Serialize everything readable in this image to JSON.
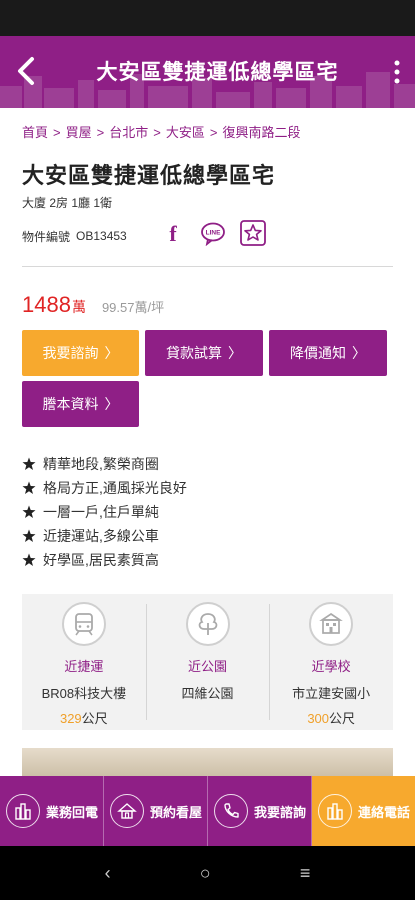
{
  "header": {
    "title": "大安區雙捷運低總學區宅"
  },
  "breadcrumb": [
    "首頁",
    "買屋",
    "台北市",
    "大安區",
    "復興南路二段"
  ],
  "listing": {
    "title": "大安區雙捷運低總學區宅",
    "spec": "大廈 2房 1廳 1衛",
    "object_label": "物件編號",
    "object_no": "OB13453",
    "price": "1488",
    "price_unit": "萬",
    "unit_price": "99.57萬/坪"
  },
  "share": {
    "facebook": "f",
    "line": "LINE"
  },
  "buttons": {
    "inquire": "我要諮詢",
    "loan": "貸款試算",
    "price_alert": "降價通知",
    "transcript": "謄本資料"
  },
  "features": [
    "精華地段,繁榮商圈",
    "格局方正,通風採光良好",
    "一層一戶,住戶單純",
    "近捷運站,多線公車",
    "好學區,居民素質高"
  ],
  "nearby": [
    {
      "title": "近捷運",
      "name": "BR08科技大樓",
      "distance": "329",
      "unit": "公尺"
    },
    {
      "title": "近公園",
      "name": "四維公園",
      "distance": "",
      "unit": ""
    },
    {
      "title": "近學校",
      "name": "市立建安國小",
      "distance": "300",
      "unit": "公尺"
    }
  ],
  "bottom_nav": [
    "業務回電",
    "預約看屋",
    "我要諮詢",
    "連絡電話"
  ],
  "android_nav": {
    "back": "‹",
    "home": "○",
    "recent": "≡"
  },
  "colors": {
    "brand_purple": "#8f1f86",
    "accent_orange": "#f7a92e",
    "price_red": "#e02424"
  }
}
